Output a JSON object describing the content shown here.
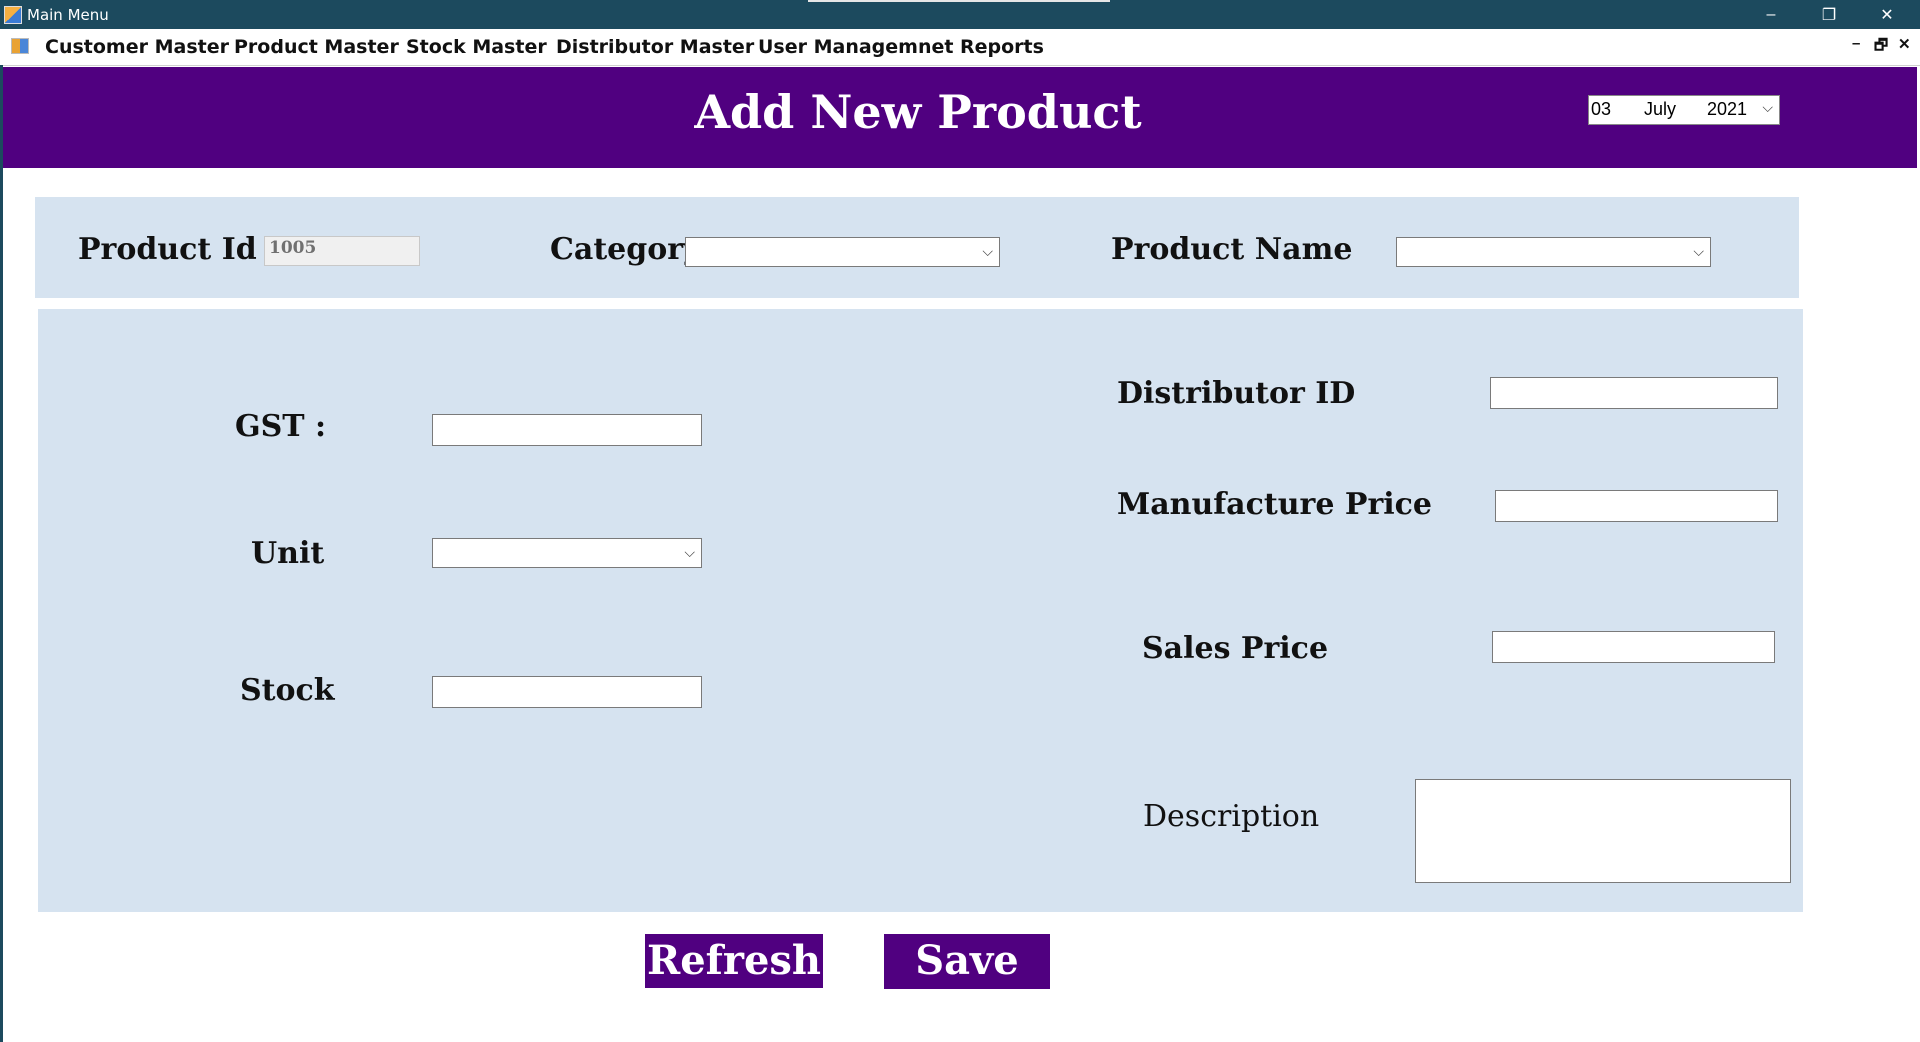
{
  "window": {
    "title": "Main Menu",
    "minimize": "–",
    "restore": "❐",
    "close": "✕"
  },
  "menu": {
    "items": [
      "Customer Master",
      "Product Master",
      "Stock Master",
      "Distributor Master",
      "User Managemnet",
      "Reports"
    ],
    "mdi_min": "–",
    "mdi_restore": "🗗",
    "mdi_close": "✕"
  },
  "header": {
    "title": "Add New Product",
    "date": {
      "day": "03",
      "month": "July",
      "year": "2021"
    }
  },
  "form": {
    "product_id_label": "Product Id",
    "product_id_value": "1005",
    "category_label": "Category",
    "product_name_label": "Product Name",
    "gst_label": "GST :",
    "unit_label": "Unit",
    "stock_label": "Stock",
    "distributor_id_label": "Distributor ID",
    "manufacture_price_label": "Manufacture Price",
    "sales_price_label": "Sales Price",
    "description_label": "Description"
  },
  "buttons": {
    "refresh": "Refresh",
    "save": "Save"
  },
  "colors": {
    "accent": "#500080",
    "panel": "#d6e3f0",
    "titlebar": "#1c4a5e"
  }
}
